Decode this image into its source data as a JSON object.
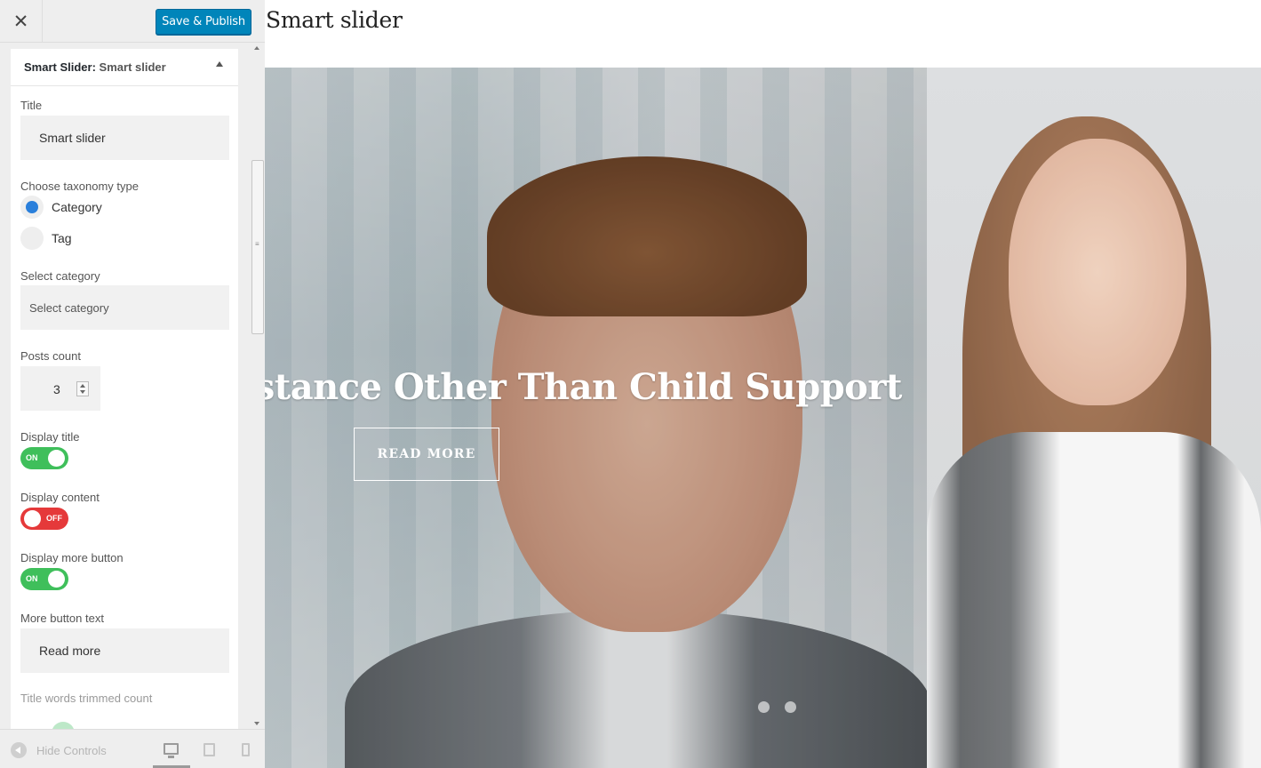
{
  "header": {
    "close_glyph": "✕",
    "save_label": "Save & Publish"
  },
  "section": {
    "prefix": "Smart Slider:",
    "name": "Smart slider"
  },
  "form": {
    "title_label": "Title",
    "title_value": "Smart slider",
    "taxonomy_label": "Choose taxonomy type",
    "taxonomy_options": [
      {
        "label": "Category",
        "checked": true
      },
      {
        "label": "Tag",
        "checked": false
      }
    ],
    "category_label": "Select category",
    "category_value": "Select category",
    "posts_count_label": "Posts count",
    "posts_count_value": "3",
    "display_title_label": "Display title",
    "display_title_state": "ON",
    "display_content_label": "Display content",
    "display_content_state": "OFF",
    "display_more_label": "Display more button",
    "display_more_state": "ON",
    "more_text_label": "More button text",
    "more_text_value": "Read more",
    "trim_label": "Title words trimmed count"
  },
  "footer": {
    "hide_controls": "Hide Controls",
    "devices": [
      "desktop-icon",
      "tablet-icon",
      "mobile-icon"
    ],
    "active_device": "desktop"
  },
  "preview": {
    "title": "Smart slider",
    "slide_caption": "istance Other Than Child Support",
    "button_label": "READ MORE",
    "dots": 2
  },
  "colors": {
    "primary_button": "#0085ba",
    "toggle_on": "#3fbf5b",
    "toggle_off": "#e5393a",
    "radio_checked": "#2a7fdb"
  }
}
